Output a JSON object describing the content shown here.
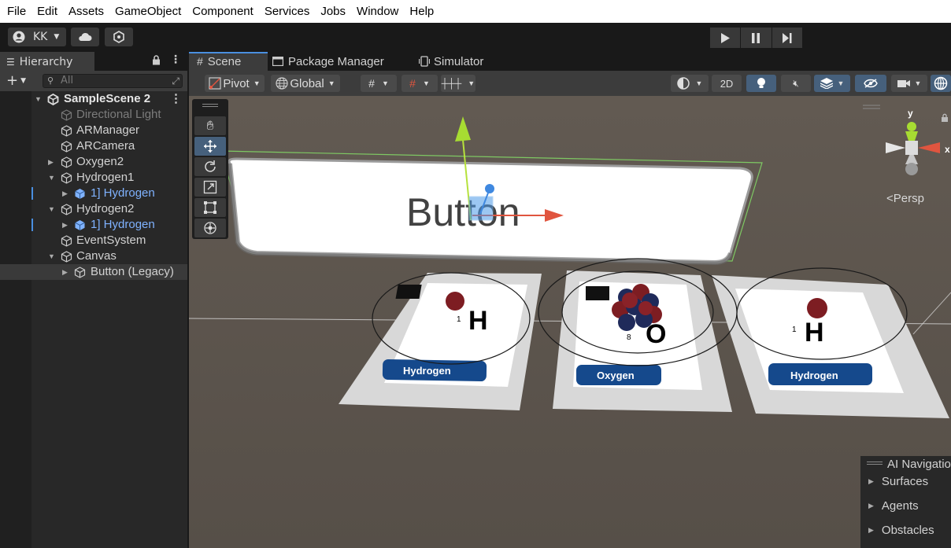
{
  "menu": [
    "File",
    "Edit",
    "Assets",
    "GameObject",
    "Component",
    "Services",
    "Jobs",
    "Window",
    "Help"
  ],
  "account": {
    "label": "KK"
  },
  "hierarchy": {
    "tab_label": "Hierarchy",
    "search_placeholder": "All",
    "items": [
      {
        "label": "SampleScene 2",
        "depth": 0,
        "expanded": true,
        "type": "scene"
      },
      {
        "label": "Directional Light",
        "depth": 1,
        "type": "object",
        "disabled": true
      },
      {
        "label": "ARManager",
        "depth": 1,
        "type": "object"
      },
      {
        "label": "ARCamera",
        "depth": 1,
        "type": "object"
      },
      {
        "label": "Oxygen2",
        "depth": 1,
        "collapsed": true,
        "type": "object"
      },
      {
        "label": "Hydrogen1",
        "depth": 1,
        "expanded": true,
        "type": "object"
      },
      {
        "label": "1] Hydrogen",
        "depth": 2,
        "collapsed": true,
        "type": "prefab"
      },
      {
        "label": "Hydrogen2",
        "depth": 1,
        "expanded": true,
        "type": "object"
      },
      {
        "label": "1] Hydrogen",
        "depth": 2,
        "collapsed": true,
        "type": "prefab"
      },
      {
        "label": "EventSystem",
        "depth": 1,
        "type": "object"
      },
      {
        "label": "Canvas",
        "depth": 1,
        "expanded": true,
        "type": "object"
      },
      {
        "label": "Button (Legacy)",
        "depth": 2,
        "collapsed": true,
        "type": "object",
        "selected": true
      }
    ]
  },
  "scene_tabs": [
    "Scene",
    "Package Manager",
    "Simulator"
  ],
  "scene_toolbar": {
    "pivot": "Pivot",
    "global": "Global",
    "mode_2d": "2D"
  },
  "viewport": {
    "button_text": "Button",
    "gizmo_axes": {
      "y": "y",
      "x": "x"
    },
    "persp_label": "Persp",
    "cards": [
      {
        "label": "Hydrogen",
        "symbol": "H",
        "number": "1"
      },
      {
        "label": "Oxygen",
        "symbol": "O",
        "number": "8"
      },
      {
        "label": "Hydrogen",
        "symbol": "H",
        "number": "1"
      }
    ]
  },
  "ai_navigation": {
    "title": "AI Navigatio",
    "items": [
      "Surfaces",
      "Agents",
      "Obstacles"
    ]
  },
  "colors": {
    "menubar": "#ffffff",
    "panel": "#282828",
    "toolbar": "#3c3c3c",
    "viewport": "#5a534c",
    "prefab_text": "#7fb2ff",
    "selected_row": "#3a3a3a",
    "accent": "#46607c"
  }
}
